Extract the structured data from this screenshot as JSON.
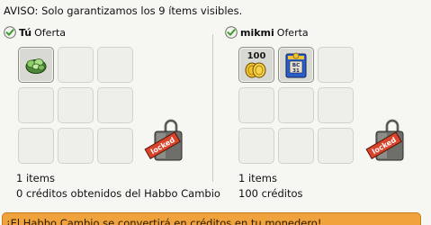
{
  "notice": "AVISO: Solo garantizamos los 9 ítems visibles.",
  "left_panel": {
    "user": "Tú",
    "offer_label": "Oferta",
    "status_icon": "check-icon",
    "items": [
      "lettuce-item",
      "",
      "",
      "",
      "",
      "",
      "",
      "",
      ""
    ],
    "lock_label": "locked",
    "count_text": "1 items",
    "detail_text": "0 créditos obtenidos del Habbo Cambio"
  },
  "right_panel": {
    "user": "mikmi",
    "offer_label": "Oferta",
    "status_icon": "check-icon",
    "items": [
      "credit-coins-item",
      "bc-box-item",
      "",
      "",
      "",
      "",
      "",
      "",
      ""
    ],
    "coin_value": "100",
    "box_label": "BC 31",
    "lock_label": "locked",
    "count_text": "1 items",
    "detail_text": "100 créditos"
  },
  "banner": "¡El Habbo Cambio se convertirá en créditos en tu monedero!",
  "colors": {
    "check_green": "#3d9b2f",
    "banner_orange": "#f0a23c",
    "lock_red": "#d8452a"
  }
}
